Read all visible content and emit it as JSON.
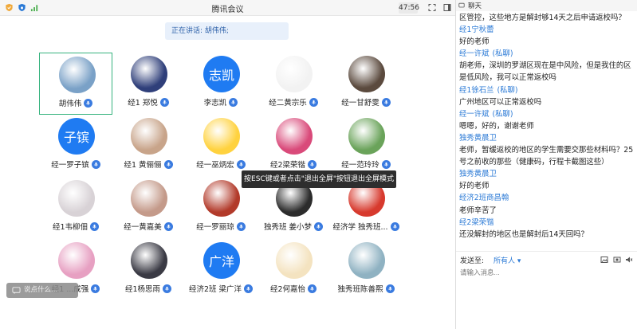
{
  "titlebar": {
    "title": "腾讯会议",
    "timer": "47:56"
  },
  "speaking": {
    "label": "正在讲话: 胡伟伟;"
  },
  "participants": [
    {
      "name": "胡伟伟",
      "avatar_text": "",
      "active": true,
      "color": "#7aa1c7"
    },
    {
      "name": "经1 郑悦",
      "avatar_text": "",
      "color": "#2f3f7a"
    },
    {
      "name": "李志凯",
      "avatar_text": "志凯",
      "color": "#1f7bf2"
    },
    {
      "name": "经二黄宗乐",
      "avatar_text": "",
      "color": "#f2f2f2"
    },
    {
      "name": "经一甘舒雯",
      "avatar_text": "",
      "color": "#5b4a3e"
    },
    {
      "name": "经一罗子镔",
      "avatar_text": "子镔",
      "color": "#1f7bf2"
    },
    {
      "name": "经1 黄俪俪",
      "avatar_text": "",
      "color": "#c8a48a"
    },
    {
      "name": "经一巫炳宏",
      "avatar_text": "",
      "color": "#ffd23f"
    },
    {
      "name": "经2梁荣锴",
      "avatar_text": "",
      "color": "#d94a7a"
    },
    {
      "name": "经一范玲玲",
      "avatar_text": "",
      "color": "#6aa35a"
    },
    {
      "name": "经1韦柳佃",
      "avatar_text": "",
      "color": "#d8d2d6"
    },
    {
      "name": "经一黄嘉美",
      "avatar_text": "",
      "color": "#c49a8a"
    },
    {
      "name": "经一罗丽琼",
      "avatar_text": "",
      "color": "#b23a2a"
    },
    {
      "name": "独秀班 姜小梦",
      "avatar_text": "",
      "color": "#2c2c2c"
    },
    {
      "name": "经济学 独秀班...",
      "avatar_text": "",
      "color": "#d73a2e"
    },
    {
      "name": "经1 ...成强",
      "avatar_text": "",
      "color": "#e7a0c2"
    },
    {
      "name": "经1杨思雨",
      "avatar_text": "",
      "color": "#3a3a44"
    },
    {
      "name": "经济2班 梁广洋",
      "avatar_text": "广洋",
      "color": "#1f7bf2"
    },
    {
      "name": "经2何嘉怡",
      "avatar_text": "",
      "color": "#f4e3c0"
    },
    {
      "name": "独秀班陈善熙",
      "avatar_text": "",
      "color": "#8fb2c2"
    }
  ],
  "tooltip": "按ESC键或者点击\"退出全屏\"按钮退出全屏模式",
  "bottom_left_input": {
    "placeholder": "说点什么..."
  },
  "chat": {
    "header": "聊天",
    "messages": [
      {
        "type": "text",
        "text": "区管控，这些地方是解封够14天之后申请返校吗？"
      },
      {
        "type": "name",
        "text": "经1宁秋蕾"
      },
      {
        "type": "text",
        "text": "好的老师"
      },
      {
        "type": "name",
        "text": "经一许斌",
        "private": "(私聊)"
      },
      {
        "type": "text",
        "text": "胡老师，深圳的罗湖区现在是中风险，但是我住的区是低风险，我可以正常返校吗"
      },
      {
        "type": "name",
        "text": "经1徐石兰",
        "private": "(私聊)"
      },
      {
        "type": "text",
        "text": "广州地区可以正常返校吗"
      },
      {
        "type": "name",
        "text": "经一许斌",
        "private": "(私聊)"
      },
      {
        "type": "text",
        "text": "嗯嗯，好的，谢谢老师"
      },
      {
        "type": "name",
        "text": "独秀黄晨卫"
      },
      {
        "type": "text",
        "text": "老师，暂缓返校的地区的学生需要交那些材料吗？25号之前收的那些（健康码，行程卡截图这些）"
      },
      {
        "type": "name",
        "text": "独秀黄晨卫"
      },
      {
        "type": "text",
        "text": "好的老师"
      },
      {
        "type": "name",
        "text": "经济2班商昌翰"
      },
      {
        "type": "text",
        "text": "老师辛苦了"
      },
      {
        "type": "name",
        "text": "经2梁荣锴"
      },
      {
        "type": "text",
        "text": "还没解封的地区也是解封后14天回吗？"
      }
    ],
    "send_to_label": "发送至:",
    "recipient": "所有人",
    "input_placeholder": "请输入消息..."
  }
}
